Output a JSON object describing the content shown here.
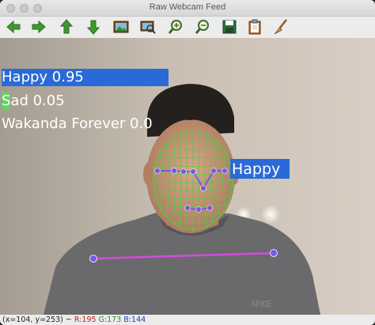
{
  "window": {
    "title": "Raw Webcam Feed"
  },
  "toolbar": {
    "buttons": [
      {
        "icon": "arrow-left-icon"
      },
      {
        "icon": "arrow-right-icon"
      },
      {
        "icon": "arrow-up-icon"
      },
      {
        "icon": "arrow-down-icon"
      },
      {
        "icon": "image-icon"
      },
      {
        "icon": "image-search-icon"
      },
      {
        "icon": "zoom-in-icon"
      },
      {
        "icon": "zoom-out-icon"
      },
      {
        "icon": "save-icon"
      },
      {
        "icon": "clipboard-icon"
      },
      {
        "icon": "brush-icon"
      }
    ]
  },
  "overlay": {
    "scores": [
      {
        "label": "Happy 0.95",
        "fraction": 0.95,
        "color": "#2a6ad6"
      },
      {
        "label": "Sad 0.05",
        "fraction": 0.05,
        "color": "#5fd45f"
      },
      {
        "label": "Wakanda Forever 0.0",
        "fraction": 0.0,
        "color": "#ffffff"
      }
    ],
    "face_label": "Happy",
    "face_label_color": "#2a6ad6",
    "mesh_color": "#44d444",
    "landmark_color": "#7a5ae0",
    "shoulder_line_color": "#d84ae0"
  },
  "statusbar": {
    "coords": "(x=104, y=253) ~ ",
    "r": "R:195",
    "g": "G:173",
    "b": "B:144"
  }
}
